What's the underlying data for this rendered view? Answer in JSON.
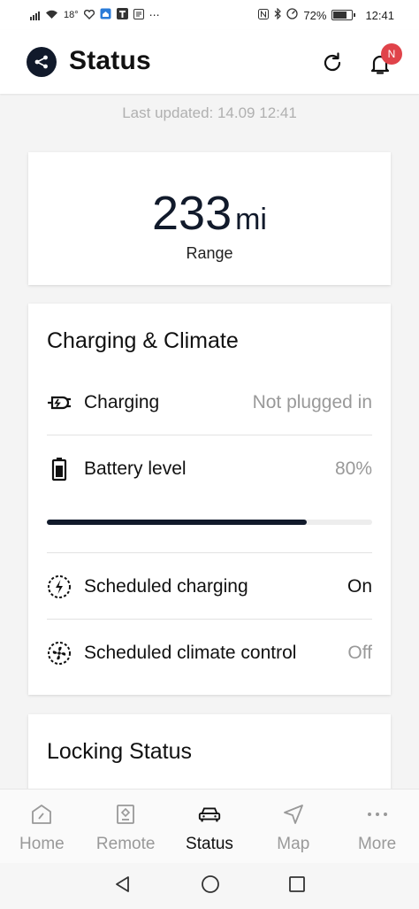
{
  "status_bar": {
    "signal": "signal-icon",
    "temperature": "18°",
    "battery_percent": "72%",
    "battery_level": 0.72,
    "time": "12:41"
  },
  "header": {
    "title": "Status",
    "badge": "N"
  },
  "last_updated": "Last updated: 14.09 12:41",
  "range": {
    "value": "233",
    "unit": "mi",
    "label": "Range"
  },
  "charging_climate": {
    "title": "Charging & Climate",
    "charging": {
      "label": "Charging",
      "value": "Not plugged in"
    },
    "battery": {
      "label": "Battery level",
      "value": "80%",
      "level": 0.8
    },
    "scheduled_charging": {
      "label": "Scheduled charging",
      "value": "On"
    },
    "scheduled_climate": {
      "label": "Scheduled climate control",
      "value": "Off"
    }
  },
  "locking": {
    "title": "Locking Status"
  },
  "tabs": [
    {
      "label": "Home",
      "icon": "home-icon",
      "active": false
    },
    {
      "label": "Remote",
      "icon": "remote-icon",
      "active": false
    },
    {
      "label": "Status",
      "icon": "car-icon",
      "active": true
    },
    {
      "label": "Map",
      "icon": "navigation-arrow-icon",
      "active": false
    },
    {
      "label": "More",
      "icon": "more-dots-icon",
      "active": false
    }
  ],
  "colors": {
    "primary": "#111a2b",
    "badge": "#e0434a",
    "muted": "#999999"
  }
}
